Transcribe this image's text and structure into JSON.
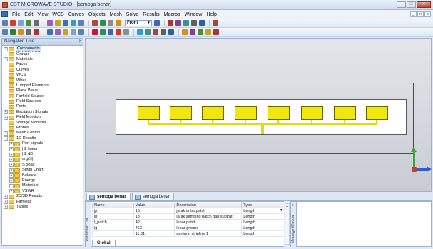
{
  "window": {
    "title": "CST MICROWAVE STUDIO - [semoga benar]",
    "controls": [
      "–",
      "□",
      "✕"
    ]
  },
  "menu": {
    "items": [
      "File",
      "Edit",
      "View",
      "WCS",
      "Curves",
      "Objects",
      "Mesh",
      "Solve",
      "Results",
      "Macros",
      "Window",
      "Help"
    ],
    "mdi_controls": [
      "_",
      "□",
      "x"
    ]
  },
  "toolbar": {
    "view_select": "Front",
    "icon_colors_row1": [
      "#5a7fb5",
      "#d23b2a",
      "#7aa3d6",
      "#4c8c3c",
      "#6b6b6b",
      "#9a5fbe",
      "#c7a21a",
      "#3c6fb8",
      "#2f9cd4",
      "#5a7fb5",
      "#b8452f",
      "#2e8b57",
      "#8d8d8d",
      "#d88f1a",
      "#4468b0",
      "#a33",
      "#7a3fa0",
      "#3f8f8f",
      "#5e5e5e",
      "#2a5ea8",
      "#b0413e"
    ],
    "icon_colors_row2": [
      "#5a7fb5",
      "#2f7d3b",
      "#d88f1a",
      "#6b6b6b",
      "#a33",
      "#3c6fb8",
      "#9a5fbe",
      "#c7a21a",
      "#7aa3d6",
      "#5a7fb5",
      "#c14",
      "#2e8b57",
      "#4468b0",
      "#d23b2a",
      "#8d8d8d",
      "#2f9cd4",
      "#3f8f8f",
      "#b0413e",
      "#5e5e5e",
      "#2a5ea8",
      "#d88f1a",
      "#7a3fa0",
      "#4c8c3c",
      "#c7a21a",
      "#a33"
    ]
  },
  "nav": {
    "title": "Navigation Tree",
    "controls": "- x",
    "items": [
      {
        "label": "Components",
        "expander": "+",
        "selected": true
      },
      {
        "label": "Groups",
        "expander": ""
      },
      {
        "label": "Materials",
        "expander": "+"
      },
      {
        "label": "Faces",
        "expander": ""
      },
      {
        "label": "Curves",
        "expander": ""
      },
      {
        "label": "WCS",
        "expander": ""
      },
      {
        "label": "Wires",
        "expander": ""
      },
      {
        "label": "Lumped Elements",
        "expander": ""
      },
      {
        "label": "Plane Wave",
        "expander": ""
      },
      {
        "label": "Farfield Source",
        "expander": ""
      },
      {
        "label": "Field Sources",
        "expander": ""
      },
      {
        "label": "Ports",
        "expander": ""
      },
      {
        "label": "Excitation Signals",
        "expander": "+"
      },
      {
        "label": "Field Monitors",
        "expander": "+"
      },
      {
        "label": "Voltage Monitors",
        "expander": ""
      },
      {
        "label": "Probes",
        "expander": ""
      },
      {
        "label": "Mesh Control",
        "expander": "+"
      },
      {
        "label": "1D Results",
        "expander": "-"
      },
      {
        "label": "Port signals",
        "expander": "+",
        "indent": 1
      },
      {
        "label": "|S| linear",
        "expander": "+",
        "indent": 1
      },
      {
        "label": "|S| dB",
        "expander": "+",
        "indent": 1
      },
      {
        "label": "arg(S)",
        "expander": "+",
        "indent": 1
      },
      {
        "label": "S polar",
        "expander": "+",
        "indent": 1
      },
      {
        "label": "Smith Chart",
        "expander": "+",
        "indent": 1
      },
      {
        "label": "Balance",
        "expander": "+",
        "indent": 1
      },
      {
        "label": "Energy",
        "expander": "+",
        "indent": 1
      },
      {
        "label": "Materials",
        "expander": "+",
        "indent": 1
      },
      {
        "label": "VSWR",
        "expander": "+",
        "indent": 1
      },
      {
        "label": "2D/3D Results",
        "expander": "+"
      },
      {
        "label": "Farfields",
        "expander": "+"
      },
      {
        "label": "Tables",
        "expander": "+"
      }
    ]
  },
  "doc_tabs": [
    {
      "label": "semoga benar",
      "active": true
    },
    {
      "label": "semoga benar",
      "active": false
    }
  ],
  "parameters": {
    "side_label": "Parameter List",
    "headers": [
      "Name",
      "Value",
      "Description",
      "Type"
    ],
    "rows": [
      [
        "jp",
        "16",
        "jarak antar patch",
        "Length"
      ],
      [
        "jp",
        "18",
        "jarak samping patch dan subtrat",
        "Length"
      ],
      [
        "l_patch",
        "42",
        "lebar patch",
        "Length"
      ],
      [
        "lg",
        "463",
        "lebar ground",
        "Length"
      ],
      [
        "",
        "11.81",
        "panjang stripline 1",
        "Length"
      ]
    ],
    "global_tab": "Global"
  },
  "messages": {
    "side_label": "Message Window",
    "controls": "x"
  }
}
